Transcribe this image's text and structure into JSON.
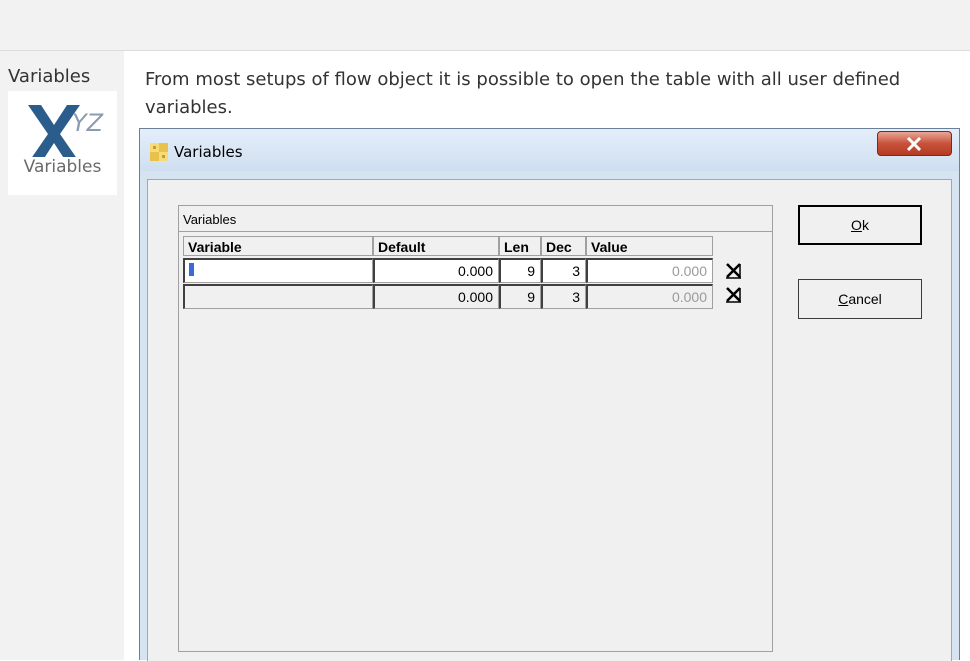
{
  "sidebar": {
    "label": "Variables",
    "tile_caption": "Variables"
  },
  "description": "From most setups of flow object it is possible to open the table with all user defined variables.",
  "dialog": {
    "title": "Variables",
    "group_title": "Variables",
    "columns": [
      "Variable",
      "Default",
      "Len",
      "Dec",
      "Value"
    ],
    "rows": [
      {
        "variable": "",
        "default": "0.000",
        "len": "9",
        "dec": "3",
        "value": "0.000"
      },
      {
        "variable": "",
        "default": "0.000",
        "len": "9",
        "dec": "3",
        "value": "0.000"
      }
    ],
    "ok_button": {
      "mnemonic": "O",
      "rest": "k"
    },
    "cancel_button": {
      "mnemonic": "C",
      "rest": "ancel"
    }
  },
  "colors": {
    "dialog_frame": "#d6e3f0",
    "close_button": "#c8523c",
    "caret": "#3a6ad8"
  },
  "icons": [
    "xyz-variables-icon",
    "variables-dialog-icon",
    "close-icon",
    "delete-row-icon"
  ]
}
